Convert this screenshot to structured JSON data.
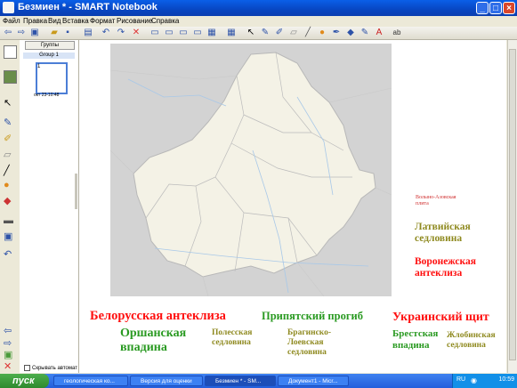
{
  "window": {
    "title": "Безмиен * - SMART Notebook",
    "minimize": "_",
    "maximize": "□",
    "close": "×"
  },
  "menu": [
    "Файл",
    "Правка",
    "Вид",
    "Вставка",
    "Формат",
    "Рисование",
    "Справка"
  ],
  "toolbar_icons": [
    "back-icon",
    "forward-icon",
    "add-page-icon",
    "open-icon",
    "save-icon",
    "paste-icon",
    "undo-icon",
    "redo-icon",
    "delete-icon",
    "screen-shade-icon",
    "show-hide-icon",
    "fullscreen-icon",
    "dual-page-icon",
    "capture-icon",
    "table-icon",
    "select-icon",
    "pen-icon",
    "creative-pen-icon",
    "eraser-icon",
    "line-icon",
    "shapes-icon",
    "magic-pen-icon",
    "fill-icon",
    "properties-icon",
    "text-icon",
    "spellcheck-icon"
  ],
  "sorter": {
    "groups_label": "Группы",
    "group_name": "Group 1",
    "thumb_number": "1",
    "thumb_date": "окт 23-10:48",
    "hide_label": "Скрывать автомат"
  },
  "labels": {
    "volyn": "Волыно-Азовская\nплита",
    "latvian": "Латвийская\nседловина",
    "voronezh": "Воронежская\nантеклиза",
    "belarus": "Белорусская антеклиза",
    "pripyat": "Припятский прогиб",
    "ukraine": "Украинский щит",
    "orsha": "Оршанская\nвпадина",
    "polesie": "Полесская\nседловина",
    "bragin": "Брагинско-\nЛоевская\nседловина",
    "brest": "Брестская\nвпадина",
    "zhlobin": "Жлобинская\nседловина"
  },
  "colors": {
    "red": "#ff1010",
    "green": "#2a9a22",
    "olive": "#8f8a20"
  },
  "taskbar": {
    "start": "пуск",
    "tasks": [
      "геологическая ко...",
      "Версия для оценки",
      "Безмиен * - SM...",
      "Документ1 - Micr..."
    ],
    "lang": "RU",
    "clock": "10:59"
  }
}
